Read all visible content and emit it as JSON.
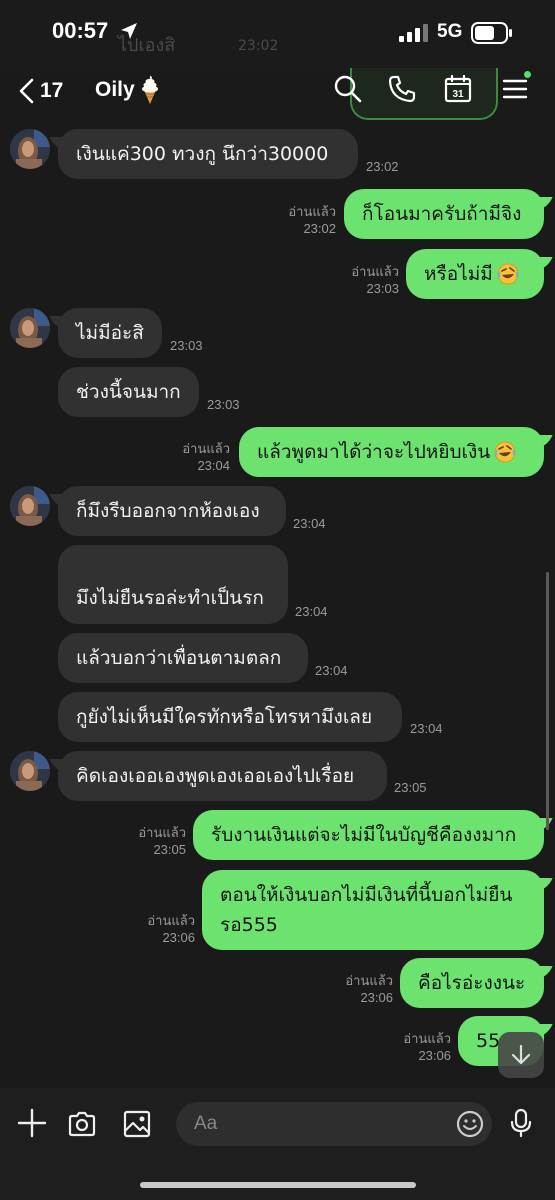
{
  "status_bar": {
    "time": "00:57",
    "network": "5G",
    "ghost_preview": "ไปเองสิ",
    "ghost_time": "23:02"
  },
  "header": {
    "back_count": "17",
    "title": "Oily",
    "title_emoji": "soft-ice-cream-icon",
    "icons": [
      "search-icon",
      "phone-icon",
      "calendar-icon",
      "menu-icon"
    ],
    "calendar_day": "31",
    "accent": "#4ee06a"
  },
  "messages": [
    {
      "side": "in",
      "text": "เงินแค่300  ทวงกู นึกว่า30000",
      "time": "23:02",
      "avatar": true
    },
    {
      "side": "out",
      "text": "ก็โอนมาครับถ้ามีจิง",
      "read": "อ่านแล้ว",
      "time": "23:02"
    },
    {
      "side": "out",
      "text": "หรือไม่มี",
      "emoji": "rofl-icon",
      "read": "อ่านแล้ว",
      "time": "23:03"
    },
    {
      "side": "in",
      "text": "ไม่มีอ่ะสิ",
      "time": "23:03",
      "avatar": true
    },
    {
      "side": "in",
      "text": "ช่วงนี้จนมาก",
      "time": "23:03"
    },
    {
      "side": "out",
      "text": "แล้วพูดมาได้ว่าจะไปหยิบเงิน",
      "emoji": "rofl-icon",
      "read": "อ่านแล้ว",
      "time": "23:04"
    },
    {
      "side": "in",
      "text": "ก็มึงรีบออกจากห้องเอง",
      "time": "23:04",
      "avatar": true
    },
    {
      "side": "in",
      "text": "มึงไม่ยืนรอล่ะทำเป็นรก",
      "time": "23:04"
    },
    {
      "side": "in",
      "text": "แล้วบอกว่าเพื่อนตามตลก",
      "time": "23:04"
    },
    {
      "side": "in",
      "text": "กูยังไม่เห็นมีใครทักหรือโทรหามึงเลย",
      "time": "23:04"
    },
    {
      "side": "in",
      "text": "คิดเองเออเองพูดเองเออเองไปเรื่อย",
      "time": "23:05",
      "avatar": true
    },
    {
      "side": "out",
      "text": "รับงานเงินแต่จะไม่มีในบัญชีคืองงมาก",
      "read": "อ่านแล้ว",
      "time": "23:05"
    },
    {
      "side": "out",
      "lines": [
        "ตอนให้เงินบอกไม่มีเงินที่นี้บอกไม่ยืน",
        "รอ555"
      ],
      "read": "อ่านแล้ว",
      "time": "23:06"
    },
    {
      "side": "out",
      "text": "คือไรอ่ะงงนะ",
      "read": "อ่านแล้ว",
      "time": "23:06"
    },
    {
      "side": "out",
      "text": "55",
      "read": "อ่านแล้ว",
      "time": "23:06"
    }
  ],
  "input_bar": {
    "placeholder": "Aa",
    "icons": [
      "plus-icon",
      "camera-icon",
      "image-icon",
      "emoji-icon",
      "microphone-icon"
    ]
  }
}
